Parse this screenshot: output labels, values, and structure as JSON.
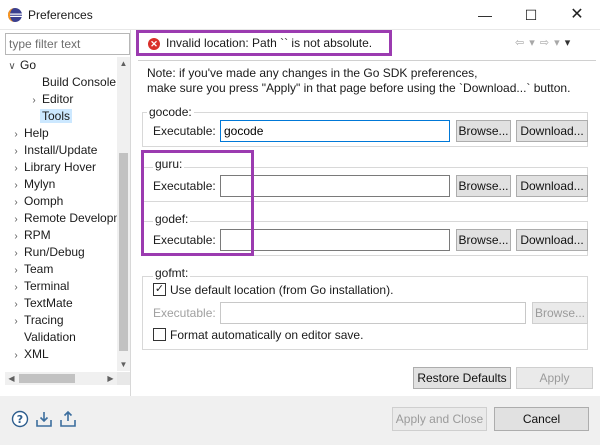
{
  "window": {
    "title": "Preferences",
    "minimize": "—",
    "maximize": "☐",
    "close": "✕"
  },
  "filter": {
    "placeholder": "type filter text"
  },
  "tree": {
    "items": [
      {
        "label": "Go",
        "arrow": "∨"
      },
      {
        "label": "Build Console",
        "arrow": ""
      },
      {
        "label": "Editor",
        "arrow": "›"
      },
      {
        "label": "Tools",
        "arrow": ""
      },
      {
        "label": "Help",
        "arrow": "›"
      },
      {
        "label": "Install/Update",
        "arrow": "›"
      },
      {
        "label": "Library Hover",
        "arrow": "›"
      },
      {
        "label": "Mylyn",
        "arrow": "›"
      },
      {
        "label": "Oomph",
        "arrow": "›"
      },
      {
        "label": "Remote Development",
        "arrow": "›"
      },
      {
        "label": "RPM",
        "arrow": "›"
      },
      {
        "label": "Run/Debug",
        "arrow": "›"
      },
      {
        "label": "Team",
        "arrow": "›"
      },
      {
        "label": "Terminal",
        "arrow": "›"
      },
      {
        "label": "TextMate",
        "arrow": "›"
      },
      {
        "label": "Tracing",
        "arrow": "›"
      },
      {
        "label": "Validation",
        "arrow": ""
      },
      {
        "label": "XML",
        "arrow": "›"
      }
    ],
    "selected": "Tools"
  },
  "error": {
    "text": "Invalid location: Path `` is not absolute.",
    "icon": "error-icon"
  },
  "nav": {
    "back": "⇦",
    "back_menu": "▾",
    "forward": "⇨",
    "forward_menu": "▾",
    "view_menu": "▾"
  },
  "note": {
    "line1": "Note: if you've made any changes in the Go SDK preferences,",
    "line2": "make sure you press \"Apply\" in that page before using the `Download...` button."
  },
  "gocode": {
    "label": "gocode:",
    "field_label": "Executable:",
    "value": "gocode",
    "browse": "Browse...",
    "download": "Download..."
  },
  "guru": {
    "label": "guru:",
    "field_label": "Executable:",
    "value": "",
    "browse": "Browse...",
    "download": "Download..."
  },
  "godef": {
    "label": "godef:",
    "field_label": "Executable:",
    "value": "",
    "browse": "Browse...",
    "download": "Download..."
  },
  "gofmt": {
    "label": "gofmt:",
    "use_default_label": "Use default location (from Go installation).",
    "use_default_checked": true,
    "field_label": "Executable:",
    "value": "",
    "browse": "Browse...",
    "format_on_save_label": "Format automatically on editor save.",
    "format_on_save_checked": false
  },
  "buttons": {
    "restore_defaults": "Restore Defaults",
    "apply": "Apply",
    "apply_and_close": "Apply and Close",
    "cancel": "Cancel"
  },
  "colors": {
    "highlight": "#9b3bb0",
    "error": "#d9302a",
    "selection": "#cce8ff"
  }
}
